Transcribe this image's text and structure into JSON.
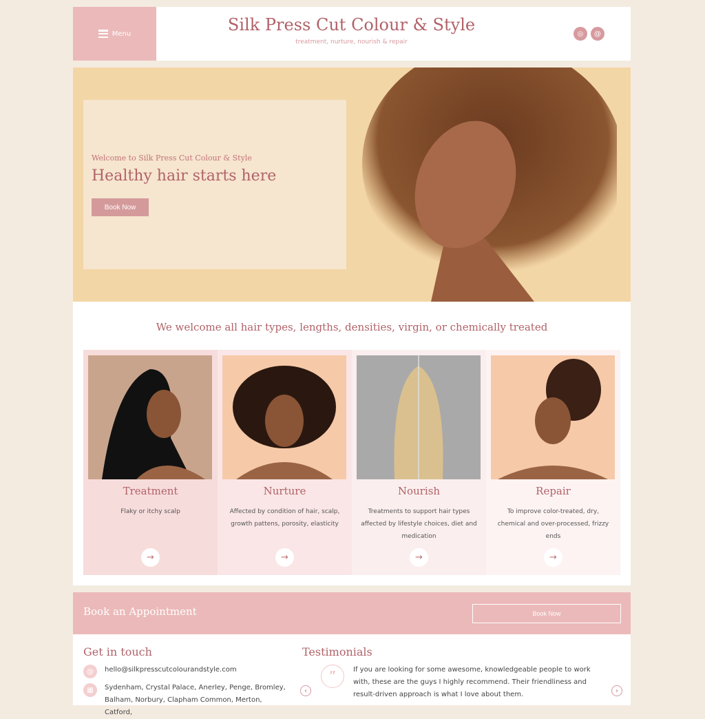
{
  "header": {
    "menu_label": "Menu",
    "title": "Silk Press Cut Colour & Style",
    "tagline": "treatment, nurture, nourish & repair",
    "social": [
      {
        "icon": "instagram-icon",
        "glyph": "◎"
      },
      {
        "icon": "email-icon",
        "glyph": "@"
      }
    ]
  },
  "hero": {
    "welcome": "Welcome to Silk Press Cut Colour & Style",
    "headline": "Healthy hair starts here",
    "button": "Book Now"
  },
  "services": {
    "heading": "We welcome all hair types, lengths, densities, virgin, or chemically treated",
    "cards": [
      {
        "title": "Treatment",
        "desc": "Flaky or itchy scalp"
      },
      {
        "title": "Nurture",
        "desc": "Affected by condition of hair, scalp, growth pattens, porosity, elasticity"
      },
      {
        "title": "Nourish",
        "desc": "Treatments to support hair types affected by lifestyle choices, diet and medication"
      },
      {
        "title": "Repair",
        "desc": "To improve color-treated, dry, chemical and over-processed, frizzy ends"
      }
    ]
  },
  "booking": {
    "title": "Book an Appointment",
    "button": "Book Now"
  },
  "contact": {
    "heading": "Get in touch",
    "email": "hello@silkpresscutcolourandstyle.com",
    "areas": "Sydenham, Crystal Palace, Anerley, Penge, Bromley, Balham, Norbury, Clapham Common, Merton, Catford,"
  },
  "testimonials": {
    "heading": "Testimonials",
    "quote": "If you are looking for some awesome, knowledgeable people to work with, these are the guys I highly recommend. Their friendliness and result-driven approach is what I love about them."
  },
  "colors": {
    "accent": "#b06268",
    "pink": "#ebb9b9",
    "hero_bg": "#f3d6a6"
  }
}
